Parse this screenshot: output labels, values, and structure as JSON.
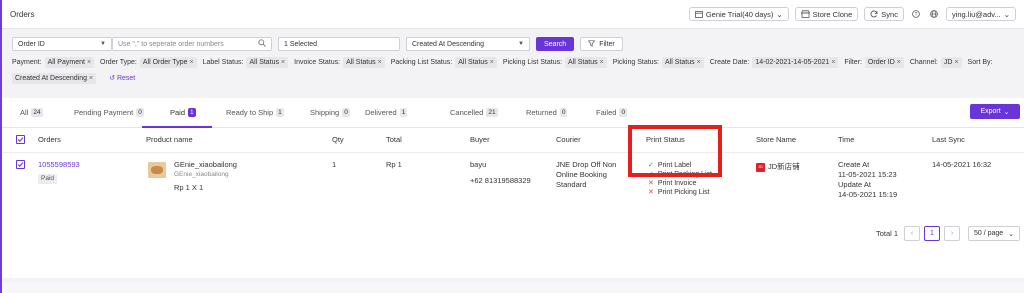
{
  "header": {
    "title": "Orders",
    "plan": "Genie Trial(40 days)",
    "store_clone": "Store Clone",
    "sync": "Sync",
    "user": "ying.liu@adv..."
  },
  "search": {
    "field_select": "Order ID",
    "placeholder": "Use \",\" to seperate order numbers",
    "selected": "1 Selected",
    "sort_select": "Created At Descending",
    "search_label": "Search",
    "filter_label": "Filter"
  },
  "filters": [
    {
      "label": "Payment:",
      "tag": "All Payment"
    },
    {
      "label": "Order Type:",
      "tag": "All Order Type"
    },
    {
      "label": "Label Status:",
      "tag": "All Status"
    },
    {
      "label": "Invoice Status:",
      "tag": "All Status"
    },
    {
      "label": "Packing List Status:",
      "tag": "All Status"
    },
    {
      "label": "Picking List Status:",
      "tag": "All Status"
    },
    {
      "label": "Picking Status:",
      "tag": "All Status"
    },
    {
      "label": "Create Date:",
      "tag": "14-02-2021-14-05-2021"
    },
    {
      "label": "Filter:",
      "tag": "Order ID"
    },
    {
      "label": "Channel:",
      "tag": "JD"
    },
    {
      "label": "Sort By:",
      "tag": "Created At Descending"
    }
  ],
  "reset_label": "Reset",
  "tabs": [
    {
      "label": "All",
      "count": "24"
    },
    {
      "label": "Pending Payment",
      "count": "0"
    },
    {
      "label": "Paid",
      "count": "1"
    },
    {
      "label": "Ready to Ship",
      "count": "1"
    },
    {
      "label": "Shipping",
      "count": "0"
    },
    {
      "label": "Delivered",
      "count": "1"
    },
    {
      "label": "Cancelled",
      "count": "21"
    },
    {
      "label": "Returned",
      "count": "0"
    },
    {
      "label": "Failed",
      "count": "0"
    }
  ],
  "export_label": "Export",
  "columns": {
    "orders": "Orders",
    "product": "Product name",
    "qty": "Qty",
    "total": "Total",
    "buyer": "Buyer",
    "courier": "Courier",
    "print_status": "Print Status",
    "store": "Store Name",
    "time": "Time",
    "last_sync": "Last Sync"
  },
  "row": {
    "order_id": "1055598593",
    "status": "Paid",
    "product_name": "GEnie_xiaobailong",
    "product_sku": "GEnie_xiaobailong",
    "product_qty_line": "Rp 1 X 1",
    "qty": "1",
    "total": "Rp 1",
    "buyer_name": "bayu",
    "buyer_phone": "+62 81319588329",
    "courier": "JNE Drop Off Non Online Booking Standard",
    "print_status": [
      {
        "label": "Print Label",
        "done": true
      },
      {
        "label": "Print Packing List",
        "done": true
      },
      {
        "label": "Print Invoice",
        "done": false
      },
      {
        "label": "Print Picking List",
        "done": false
      }
    ],
    "store_name": "JD新店铺",
    "created_label": "Create At",
    "created_at": "11-05-2021 15:23",
    "updated_label": "Update At",
    "updated_at": "14-05-2021 15:19",
    "last_sync": "14-05-2021 16:32"
  },
  "pagination": {
    "total": "Total 1",
    "page": "1",
    "page_size": "50 / page"
  },
  "colors": {
    "accent": "#6a35d8",
    "highlight_box": "#e61e1e",
    "success": "#2e9e4a",
    "fail": "#e0443e"
  }
}
